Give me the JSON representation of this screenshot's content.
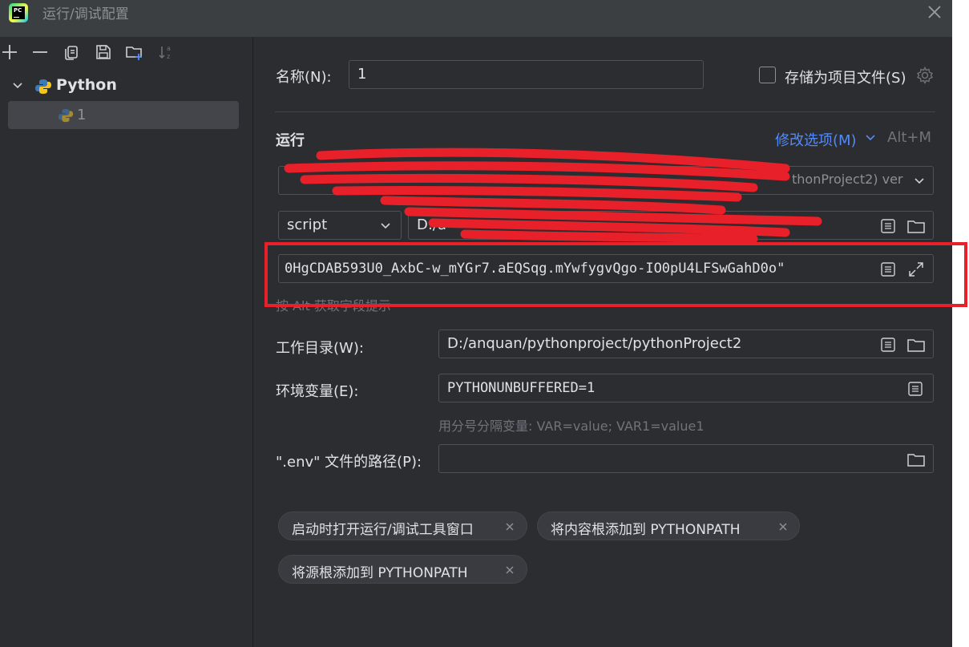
{
  "window": {
    "title": "运行/调试配置",
    "app_icon": "pycharm-icon",
    "app_icon_label": "PC"
  },
  "toolbar": {
    "icons": [
      "add-icon",
      "remove-icon",
      "copy-icon",
      "save-icon",
      "new-folder-icon",
      "sort-icon"
    ]
  },
  "tree": {
    "group_label": "Python",
    "item_label": "1"
  },
  "form": {
    "name_label": "名称(N):",
    "name_value": "1",
    "store_checkbox_label": "存储为项目文件(S)",
    "store_checkbox_checked": false,
    "section_run": "运行",
    "modify_options": "修改选项(M)",
    "modify_shortcut": "Alt+M",
    "interpreter_value": "thonProject2) ver",
    "script_type": "script",
    "script_path": "D:/a",
    "parameters_value": "0HgCDAB593U0_AxbC-w_mYGr7.aEQSqg.mYwfygvQgo-IO0pU4LFSwGahD0o\"",
    "parameters_hint": "按 Alt 获取字段提示",
    "workdir_label": "工作目录(W):",
    "workdir_value": "D:/anquan/pythonproject/pythonProject2",
    "env_label": "环境变量(E):",
    "env_value": "PYTHONUNBUFFERED=1",
    "env_hint": "用分号分隔变量: VAR=value; VAR1=value1",
    "dotenv_label": "\".env\" 文件的路径(P):",
    "dotenv_value": ""
  },
  "chips": [
    {
      "label": "启动时打开运行/调试工具窗口"
    },
    {
      "label": "将内容根添加到 PYTHONPATH"
    },
    {
      "label": "将源根添加到 PYTHONPATH"
    }
  ],
  "colors": {
    "background": "#2b2d30",
    "titlebar": "#3c3f41",
    "accent_link": "#548af7",
    "annotation_red": "#e8202a"
  }
}
